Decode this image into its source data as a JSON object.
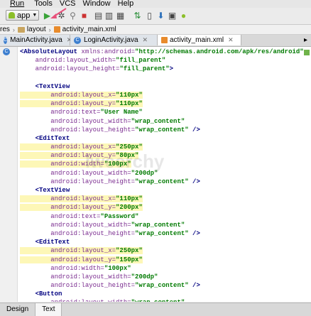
{
  "menu": [
    "Run",
    "Tools",
    "VCS",
    "Window",
    "Help"
  ],
  "toolbar": {
    "config_label": "app",
    "icons": [
      "android-icon",
      "run-icon",
      "debug-icon",
      "attach-icon",
      "stop-icon",
      "sync-icon",
      "avd-icon",
      "sdk-icon",
      "monitor-icon"
    ]
  },
  "breadcrumb": {
    "items": [
      "res",
      "layout",
      "activity_main.xml"
    ]
  },
  "tabs": [
    {
      "label": "MainActivity.java",
      "icon": "class-icon"
    },
    {
      "label": "LoginActivity.java",
      "icon": "class-icon"
    },
    {
      "label": "activity_main.xml",
      "icon": "xml-icon"
    }
  ],
  "watermark": "Iweerchy",
  "code": [
    [
      {
        "t": "<",
        "c": "tag"
      },
      {
        "t": "AbsoluteLayout",
        "c": "tag"
      },
      {
        "t": " xmlns:android=",
        "c": "attr"
      },
      {
        "t": "\"http://schemas.android.com/apk/res/android\"",
        "c": "val"
      }
    ],
    [
      {
        "t": "    android:layout_width=",
        "c": "attr"
      },
      {
        "t": "\"fill_parent\"",
        "c": "val"
      }
    ],
    [
      {
        "t": "    android:layout_height=",
        "c": "attr"
      },
      {
        "t": "\"fill_parent\"",
        "c": "val"
      },
      {
        "t": ">",
        "c": "tag"
      }
    ],
    [
      {
        "t": "",
        "c": "plain"
      }
    ],
    [
      {
        "t": "    <",
        "c": "tag"
      },
      {
        "t": "TextView",
        "c": "tag"
      }
    ],
    [
      {
        "t": "        android:layout_x=",
        "c": "attr hl"
      },
      {
        "t": "\"110px\"",
        "c": "val hl"
      }
    ],
    [
      {
        "t": "        android:layout_y=",
        "c": "attr hl"
      },
      {
        "t": "\"110px\"",
        "c": "val hl"
      }
    ],
    [
      {
        "t": "        android:text=",
        "c": "attr"
      },
      {
        "t": "\"User Name\"",
        "c": "val"
      }
    ],
    [
      {
        "t": "        android:layout_width=",
        "c": "attr"
      },
      {
        "t": "\"wrap_content\"",
        "c": "val"
      }
    ],
    [
      {
        "t": "        android:layout_height=",
        "c": "attr"
      },
      {
        "t": "\"wrap_content\"",
        "c": "val"
      },
      {
        "t": " />",
        "c": "tag"
      }
    ],
    [
      {
        "t": "    <",
        "c": "tag"
      },
      {
        "t": "EditText",
        "c": "tag"
      }
    ],
    [
      {
        "t": "        android:layout_x=",
        "c": "attr hl"
      },
      {
        "t": "\"250px\"",
        "c": "val hl"
      }
    ],
    [
      {
        "t": "        android:layout_y=",
        "c": "attr hl"
      },
      {
        "t": "\"80px\"",
        "c": "val hl"
      }
    ],
    [
      {
        "t": "        android:width=",
        "c": "attr hl"
      },
      {
        "t": "\"100px\"",
        "c": "val hl"
      }
    ],
    [
      {
        "t": "        android:layout_width=",
        "c": "attr"
      },
      {
        "t": "\"200dp\"",
        "c": "val"
      }
    ],
    [
      {
        "t": "        android:layout_height=",
        "c": "attr"
      },
      {
        "t": "\"wrap_content\"",
        "c": "val"
      },
      {
        "t": " />",
        "c": "tag"
      }
    ],
    [
      {
        "t": "    <",
        "c": "tag"
      },
      {
        "t": "TextView",
        "c": "tag"
      }
    ],
    [
      {
        "t": "        android:layout_x=",
        "c": "attr hl"
      },
      {
        "t": "\"110px\"",
        "c": "val hl"
      }
    ],
    [
      {
        "t": "        android:layout_y=",
        "c": "attr hl"
      },
      {
        "t": "\"200px\"",
        "c": "val hl"
      }
    ],
    [
      {
        "t": "        android:text=",
        "c": "attr"
      },
      {
        "t": "\"Password\"",
        "c": "val"
      }
    ],
    [
      {
        "t": "        android:layout_width=",
        "c": "attr"
      },
      {
        "t": "\"wrap_content\"",
        "c": "val"
      }
    ],
    [
      {
        "t": "        android:layout_height=",
        "c": "attr"
      },
      {
        "t": "\"wrap_content\"",
        "c": "val"
      },
      {
        "t": " />",
        "c": "tag"
      }
    ],
    [
      {
        "t": "    <",
        "c": "tag"
      },
      {
        "t": "EditText",
        "c": "tag"
      }
    ],
    [
      {
        "t": "        android:layout_x=",
        "c": "attr hl"
      },
      {
        "t": "\"250px\"",
        "c": "val hl"
      }
    ],
    [
      {
        "t": "        android:layout_y=",
        "c": "attr hl"
      },
      {
        "t": "\"150px\"",
        "c": "val hl"
      }
    ],
    [
      {
        "t": "        android:width=",
        "c": "attr"
      },
      {
        "t": "\"100px\"",
        "c": "val"
      }
    ],
    [
      {
        "t": "        android:layout_width=",
        "c": "attr"
      },
      {
        "t": "\"200dp\"",
        "c": "val"
      }
    ],
    [
      {
        "t": "        android:layout_height=",
        "c": "attr"
      },
      {
        "t": "\"wrap_content\"",
        "c": "val"
      },
      {
        "t": " />",
        "c": "tag"
      }
    ],
    [
      {
        "t": "    <",
        "c": "tag"
      },
      {
        "t": "Button",
        "c": "tag"
      }
    ],
    [
      {
        "t": "        android:layout_width=",
        "c": "attr"
      },
      {
        "t": "\"wrap_content\"",
        "c": "val"
      }
    ],
    [
      {
        "t": "        android:layout_height=",
        "c": "attr"
      },
      {
        "t": "\"wrap_content\"",
        "c": "val"
      }
    ]
  ],
  "bottom_tabs": [
    "Design",
    "Text"
  ],
  "colors": {
    "tag": "#000080",
    "attr": "#7a2b8f",
    "value": "#007a00",
    "highlight": "#fdf7b7"
  }
}
